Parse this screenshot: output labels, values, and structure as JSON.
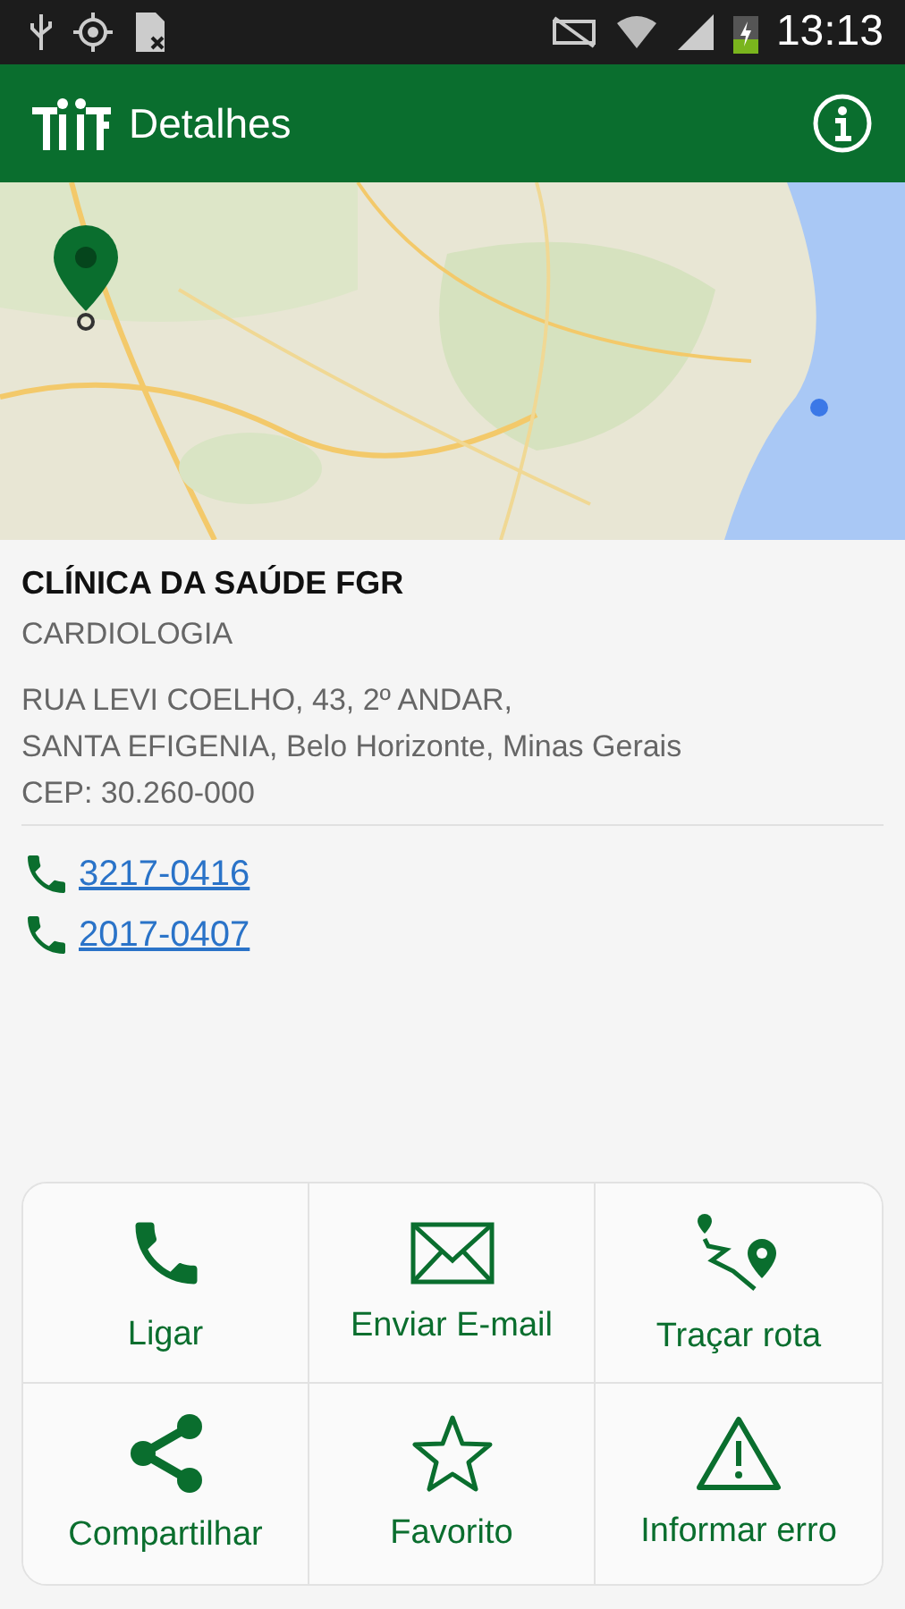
{
  "status_bar": {
    "time": "13:13"
  },
  "app_bar": {
    "title": "Detalhes"
  },
  "map": {
    "kind": "picture"
  },
  "clinic": {
    "name": "CLÍNICA DA SAÚDE FGR",
    "specialty": "CARDIOLOGIA",
    "address_lines": [
      "RUA LEVI COELHO, 43, 2º ANDAR,",
      "SANTA EFIGENIA, Belo Horizonte, Minas Gerais",
      "CEP: 30.260-000"
    ]
  },
  "phones": [
    "3217-0416",
    "2017-0407"
  ],
  "actions": [
    {
      "kind": "call",
      "label": "Ligar"
    },
    {
      "kind": "email",
      "label": "Enviar E-mail"
    },
    {
      "kind": "route",
      "label": "Traçar rota"
    },
    {
      "kind": "share",
      "label": "Compartilhar"
    },
    {
      "kind": "favorite",
      "label": "Favorito"
    },
    {
      "kind": "report",
      "label": "Informar erro"
    }
  ]
}
